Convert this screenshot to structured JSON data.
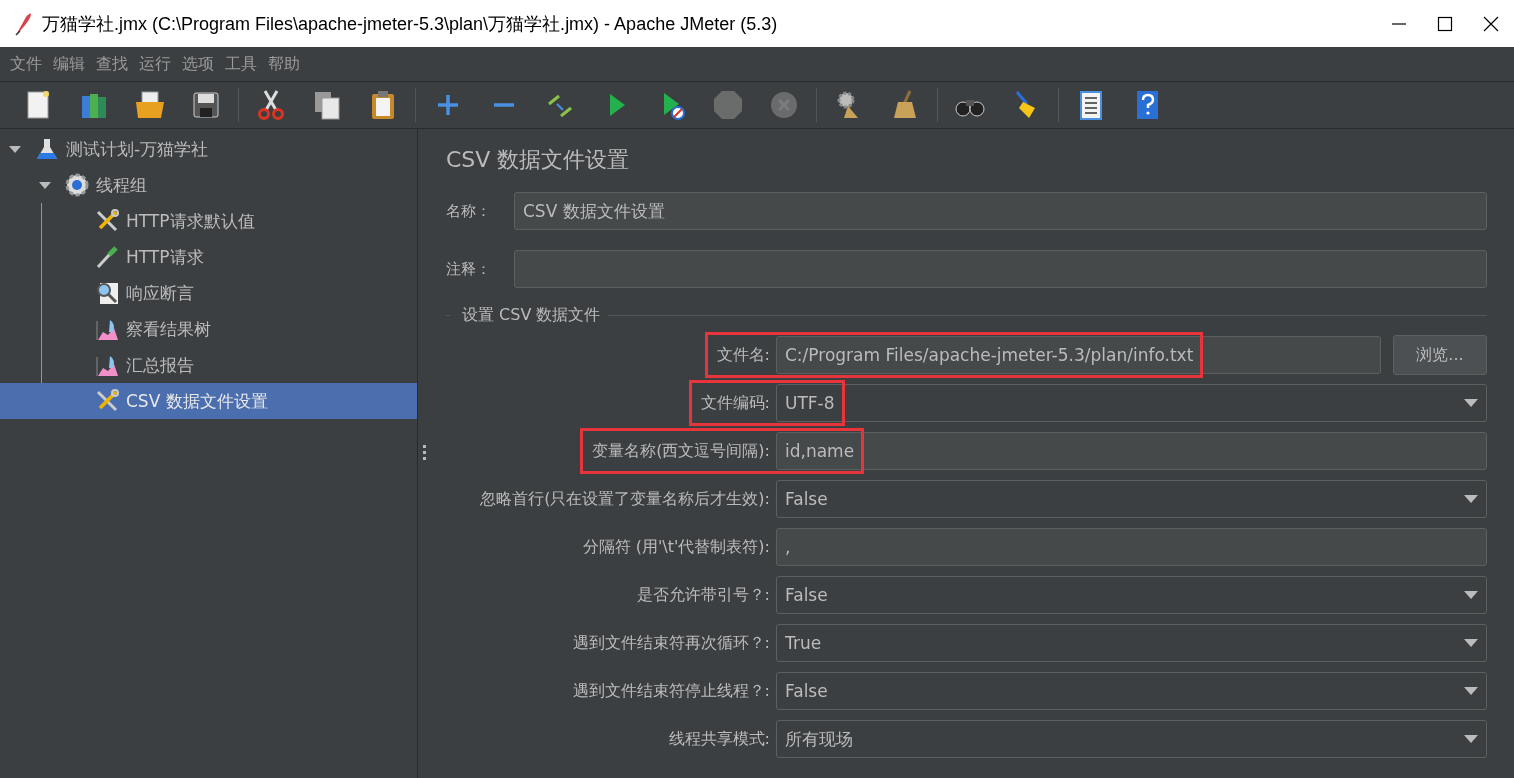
{
  "window": {
    "title": "万猫学社.jmx (C:\\Program Files\\apache-jmeter-5.3\\plan\\万猫学社.jmx) - Apache JMeter (5.3)"
  },
  "menu": [
    "文件",
    "编辑",
    "查找",
    "运行",
    "选项",
    "工具",
    "帮助"
  ],
  "toolbar": [
    {
      "kind": "new"
    },
    {
      "kind": "templates"
    },
    {
      "kind": "open"
    },
    {
      "kind": "save"
    },
    {
      "kind": "sep"
    },
    {
      "kind": "cut"
    },
    {
      "kind": "copy"
    },
    {
      "kind": "paste"
    },
    {
      "kind": "sep"
    },
    {
      "kind": "expand"
    },
    {
      "kind": "collapse"
    },
    {
      "kind": "toggle"
    },
    {
      "kind": "start"
    },
    {
      "kind": "start-nopause"
    },
    {
      "kind": "stop",
      "disabled": true
    },
    {
      "kind": "shutdown",
      "disabled": true
    },
    {
      "kind": "sep"
    },
    {
      "kind": "clear"
    },
    {
      "kind": "clear-all"
    },
    {
      "kind": "sep"
    },
    {
      "kind": "search"
    },
    {
      "kind": "reset"
    },
    {
      "kind": "sep"
    },
    {
      "kind": "function"
    },
    {
      "kind": "help"
    }
  ],
  "tree": [
    {
      "label": "测试计划-万猫学社",
      "kind": "flask",
      "expanded": true,
      "selected": false,
      "children": [
        {
          "label": "线程组",
          "kind": "gear",
          "expanded": true,
          "selected": false,
          "children": [
            {
              "label": "HTTP请求默认值",
              "kind": "tools",
              "selected": false
            },
            {
              "label": "HTTP请求",
              "kind": "pipette",
              "selected": false
            },
            {
              "label": "响应断言",
              "kind": "magnifier",
              "selected": false
            },
            {
              "label": "察看结果树",
              "kind": "graph",
              "selected": false
            },
            {
              "label": "汇总报告",
              "kind": "graph",
              "selected": false
            },
            {
              "label": "CSV 数据文件设置",
              "kind": "tools",
              "selected": true
            }
          ]
        }
      ]
    }
  ],
  "panel": {
    "title": "CSV 数据文件设置",
    "name": {
      "label": "名称：",
      "value": "CSV 数据文件设置"
    },
    "comment": {
      "label": "注释："
    },
    "group_title": "设置 CSV 数据文件",
    "rows": [
      {
        "label": "文件名:",
        "kind": "text",
        "value": "C:/Program Files/apache-jmeter-5.3/plan/info.txt",
        "button": "浏览...",
        "highlighted": true
      },
      {
        "label": "文件编码:",
        "kind": "select",
        "value": "UTF-8",
        "highlighted": true
      },
      {
        "label": "变量名称(西文逗号间隔):",
        "kind": "text",
        "value": "id,name",
        "highlighted": true
      },
      {
        "label": "忽略首行(只在设置了变量名称后才生效):",
        "kind": "select",
        "value": "False",
        "highlighted": false
      },
      {
        "label": "分隔符 (用'\\t'代替制表符):",
        "kind": "text",
        "value": ",",
        "highlighted": false
      },
      {
        "label": "是否允许带引号？:",
        "kind": "select",
        "value": "False",
        "highlighted": false
      },
      {
        "label": "遇到文件结束符再次循环？:",
        "kind": "select",
        "value": "True",
        "highlighted": false
      },
      {
        "label": "遇到文件结束符停止线程？:",
        "kind": "select",
        "value": "False",
        "highlighted": false
      },
      {
        "label": "线程共享模式:",
        "kind": "select",
        "value": "所有现场",
        "highlighted": false
      }
    ]
  }
}
